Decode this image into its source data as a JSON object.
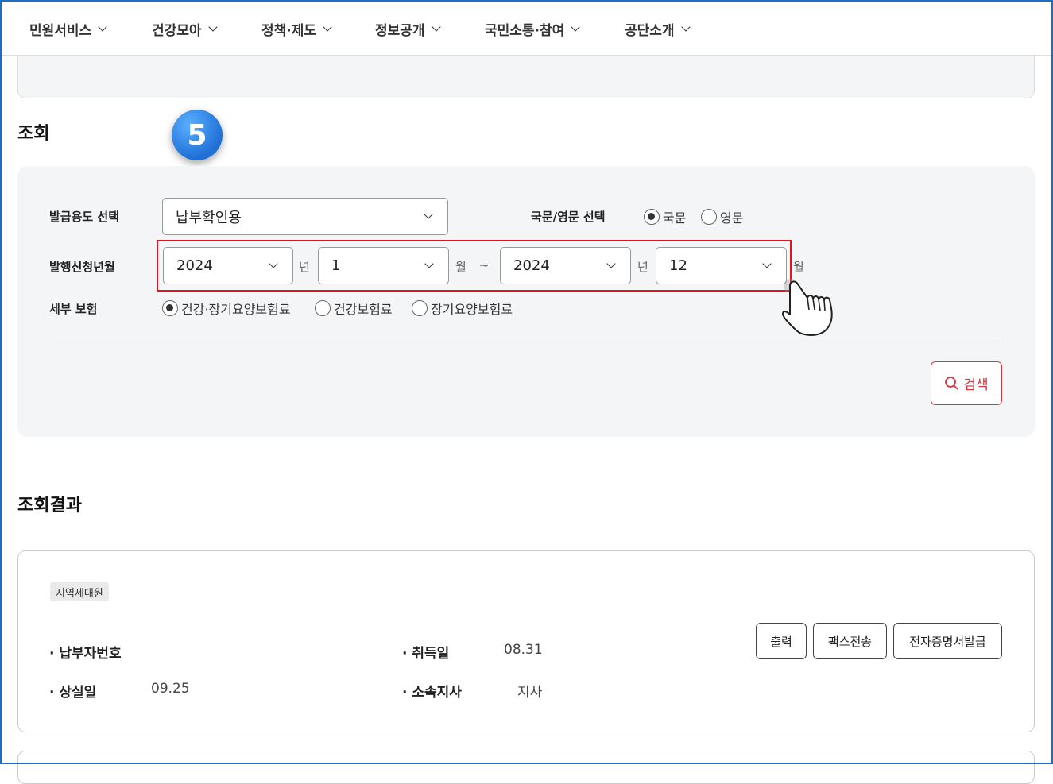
{
  "nav": {
    "items": [
      "민원서비스",
      "건강모아",
      "정책·제도",
      "정보공개",
      "국민소통·참여",
      "공단소개"
    ]
  },
  "step_badge": "5",
  "query": {
    "heading": "조회",
    "purpose_label": "발급용도 선택",
    "purpose_value": "납부확인용",
    "lang_label": "국문/영문 선택",
    "lang_options": [
      "국문",
      "영문"
    ],
    "lang_selected": "국문",
    "period_label": "발행신청년월",
    "start_year": "2024",
    "start_month": "1",
    "end_year": "2024",
    "end_month": "12",
    "unit_year": "년",
    "unit_month": "월",
    "tilde": "~",
    "detail_label": "세부 보험",
    "detail_options": [
      "건강·장기요양보험료",
      "건강보험료",
      "장기요양보험료"
    ],
    "detail_selected": "건강·장기요양보험료",
    "search_button": "검색"
  },
  "result": {
    "heading": "조회결과",
    "tag": "지역세대원",
    "fields": {
      "payer_no_label": "납부자번호",
      "payer_no_value": "",
      "acquired_label": "취득일",
      "acquired_value": "08.31",
      "lost_label": "상실일",
      "lost_value": "09.25",
      "branch_label": "소속지사",
      "branch_value": "지사"
    },
    "buttons": [
      "출력",
      "팩스전송",
      "전자증명서발급"
    ]
  },
  "colors": {
    "accent_red": "#e0141e",
    "frame_blue": "#1a6fc4",
    "step_blue": "#1f6fd6"
  }
}
